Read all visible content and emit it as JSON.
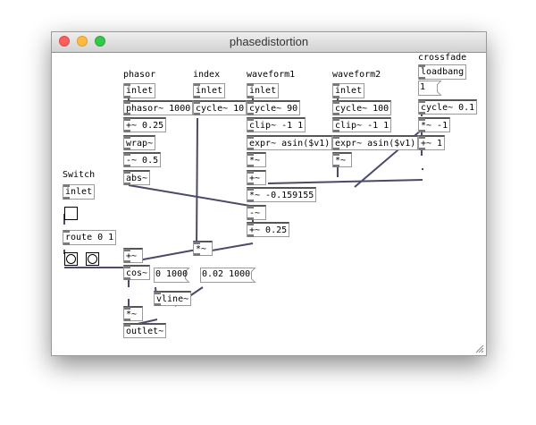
{
  "window": {
    "title": "phasedistortion"
  },
  "labels": {
    "phasor": "phasor",
    "index": "index",
    "waveform1": "waveform1",
    "waveform2": "waveform2",
    "crossfade": "crossfade",
    "switch": "Switch"
  },
  "objects": {
    "inlet_phasor": "inlet",
    "inlet_index": "inlet",
    "inlet_wave1": "inlet",
    "inlet_wave2": "inlet",
    "loadbang": "loadbang",
    "phasor_1000": "phasor~ 1000",
    "cycle_10": "cycle~ 10",
    "cycle_90": "cycle~ 90",
    "cycle_100": "cycle~ 100",
    "cycle_01": "cycle~ 0.1",
    "plus_025": "+~ 0.25",
    "clip_1": "clip~ -1 1",
    "clip_2": "clip~ -1 1",
    "times_m1": "*~ -1",
    "wrap": "wrap~",
    "expr_1": "expr~ asin($v1)",
    "expr_2": "expr~ asin($v1)",
    "plus_1": "+~ 1",
    "minus_05": "-~ 0.5",
    "mul_a": "*~",
    "mul_b": "*~",
    "plus_a": "+~",
    "abs": "abs~",
    "inlet_switch": "inlet",
    "mul_const": "*~ -0.159155",
    "minus_a": "-~",
    "plus_025b": "+~ 0.25",
    "route": "route 0 1",
    "plus_b": "+~",
    "mul_c": "*~",
    "cos": "cos~",
    "vline": "vline~",
    "mul_d": "*~",
    "outlet": "outlet~"
  },
  "messages": {
    "msg_1": "1",
    "msg_0_1000": "0 1000",
    "msg_002_1000": "0.02 1000"
  }
}
